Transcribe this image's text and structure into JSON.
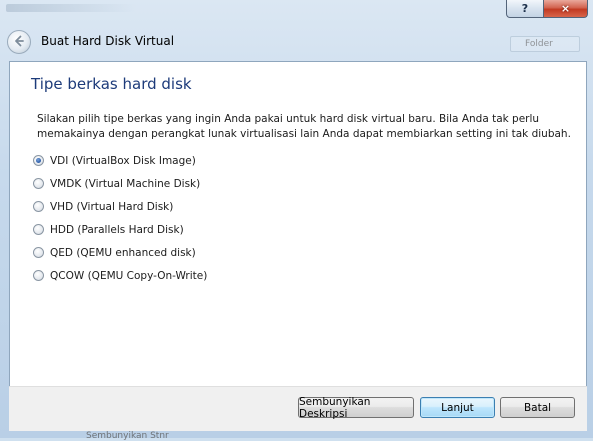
{
  "window": {
    "help_label": "?",
    "close_label": "×"
  },
  "header": {
    "title": "Buat Hard Disk Virtual",
    "back_icon": "back-arrow-icon",
    "background_button_label": "Folder"
  },
  "main": {
    "section_title": "Tipe berkas hard disk",
    "description": "Silakan pilih tipe berkas yang ingin Anda pakai untuk hard disk virtual baru. Bila Anda tak perlu memakainya dengan perangkat lunak virtualisasi lain Anda dapat membiarkan setting ini tak diubah.",
    "options": [
      {
        "label": "VDI (VirtualBox Disk Image)",
        "selected": true
      },
      {
        "label": "VMDK (Virtual Machine Disk)",
        "selected": false
      },
      {
        "label": "VHD (Virtual Hard Disk)",
        "selected": false
      },
      {
        "label": "HDD (Parallels Hard Disk)",
        "selected": false
      },
      {
        "label": "QED (QEMU enhanced disk)",
        "selected": false
      },
      {
        "label": "QCOW (QEMU Copy-On-Write)",
        "selected": false
      }
    ]
  },
  "buttons": {
    "hide_description": "Sembunyikan Deskripsi",
    "next": "Lanjut",
    "cancel": "Batal"
  },
  "background": {
    "under_text": "Sembunyikan Stnr"
  },
  "colors": {
    "title_blue": "#1d3b7a",
    "frame": "#c6d9ec",
    "close_red": "#c23a22"
  }
}
